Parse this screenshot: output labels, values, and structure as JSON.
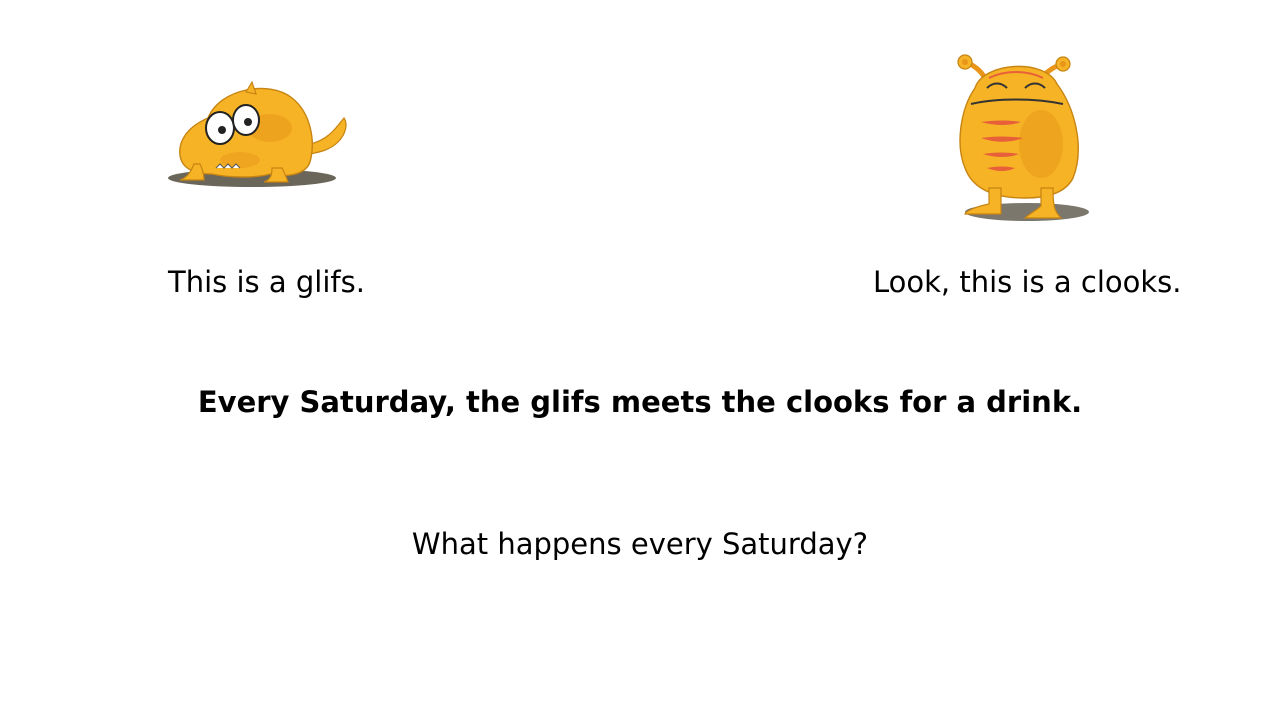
{
  "slide": {
    "glifs": {
      "icon": "glifs-creature-illustration",
      "caption": "This is a glifs."
    },
    "clooks": {
      "icon": "clooks-creature-illustration",
      "caption": "Look, this is a clooks."
    },
    "statement": "Every Saturday, the glifs meets the clooks for a drink.",
    "question": "What happens every Saturday?"
  },
  "colors": {
    "creature_body": "#f5b325",
    "creature_shade": "#e8951a",
    "stripe": "#e8603a",
    "shadow": "#5a5548",
    "background": "#ffffff"
  }
}
